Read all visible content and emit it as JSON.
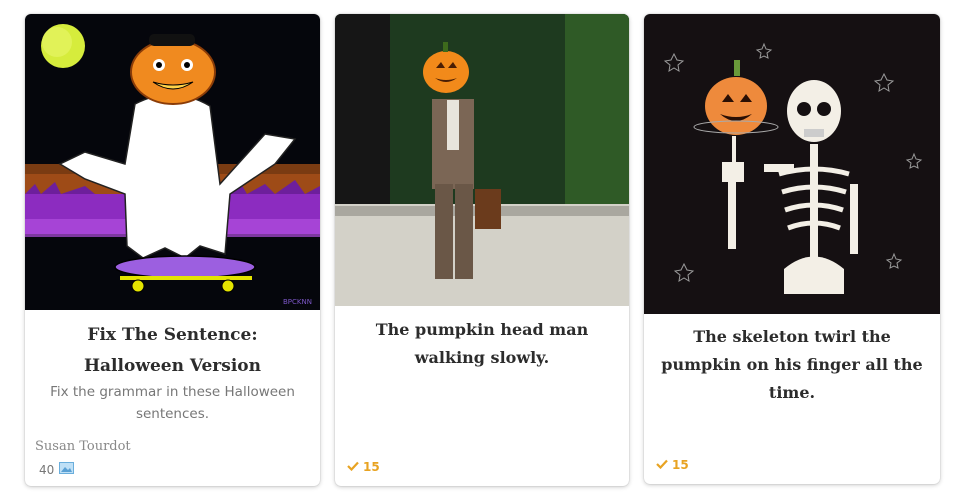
{
  "cards": [
    {
      "title": "Fix The Sentence: Halloween Version",
      "description": "Fix the grammar in these Halloween sentences.",
      "author": "Susan Tourdot",
      "count": "40",
      "count_icon": "image-icon",
      "art_signature": "BPCKNN"
    },
    {
      "title": "The pumpkin head man walking slowly.",
      "likes": "15",
      "likes_icon": "checkmark-icon"
    },
    {
      "title": "The skeleton twirl the pumpkin on his finger all the time.",
      "likes": "15",
      "likes_icon": "checkmark-icon"
    }
  ],
  "colors": {
    "accent": "#e8a322",
    "title_text": "#2c2c2c",
    "muted_text": "#777777"
  }
}
